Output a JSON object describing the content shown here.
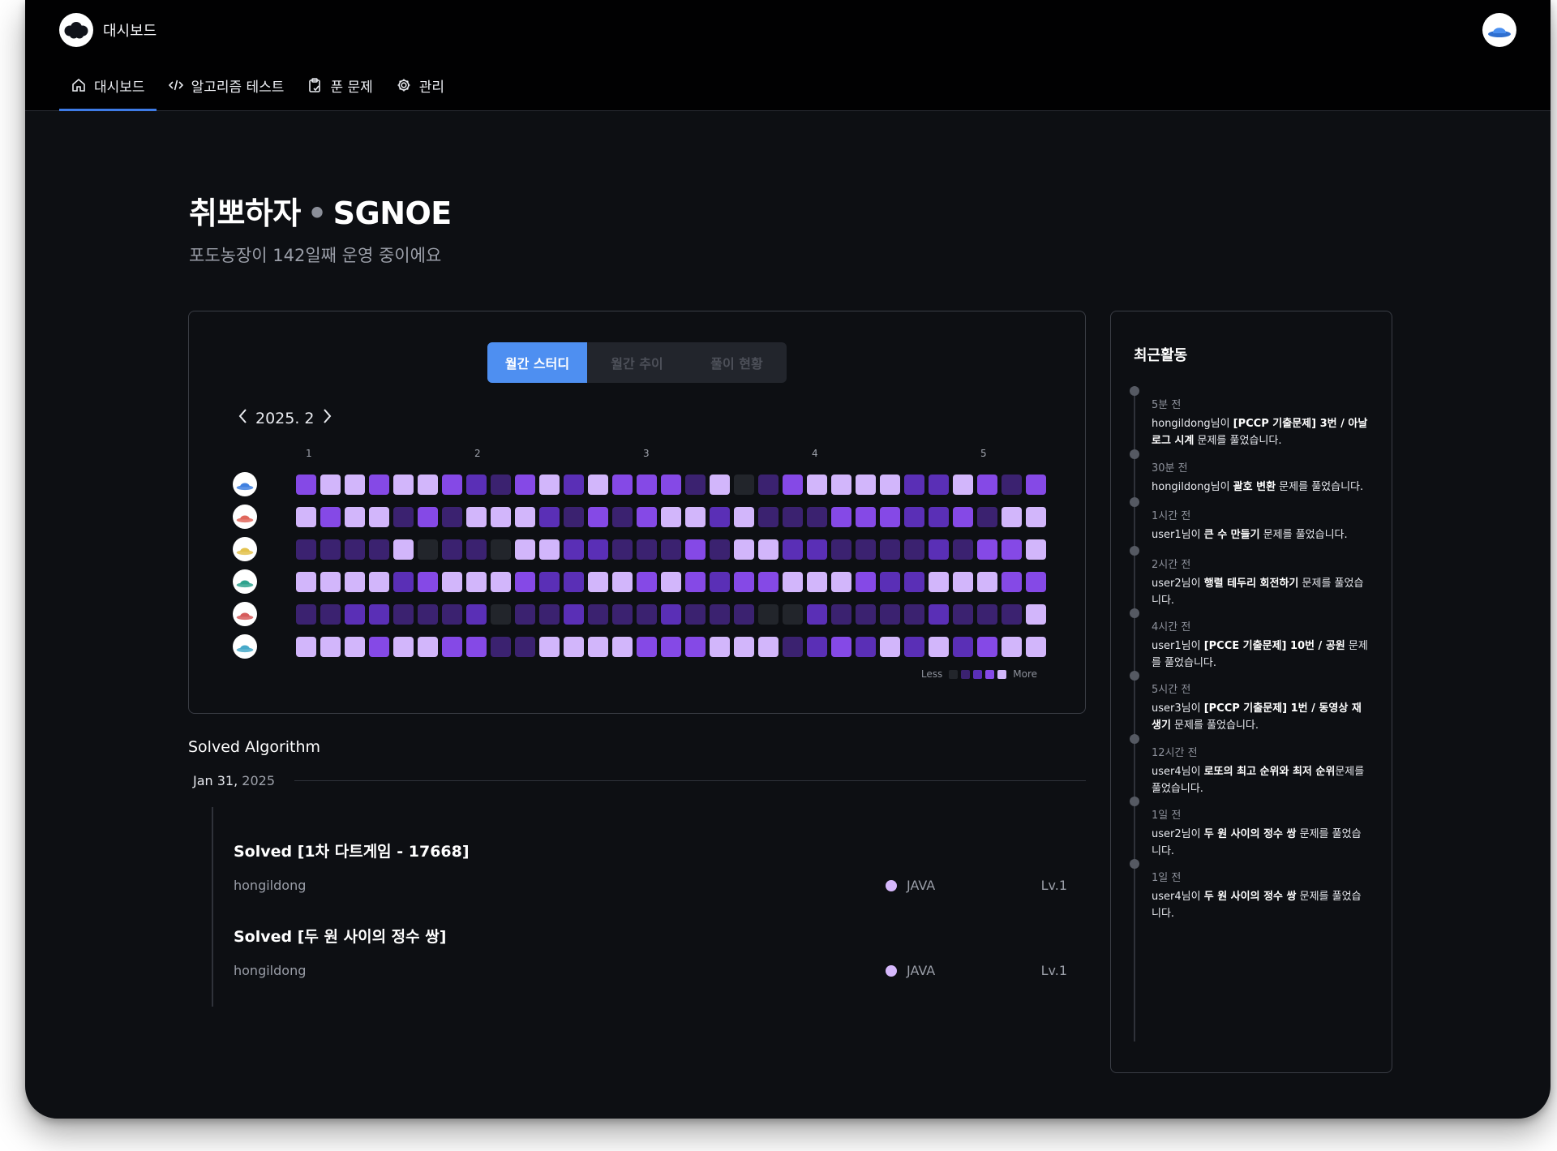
{
  "app": {
    "brand_title": "대시보드",
    "nav": [
      {
        "label": "대시보드",
        "icon": "home-icon",
        "active": true
      },
      {
        "label": "알고리즘 테스트",
        "icon": "code-icon",
        "active": false
      },
      {
        "label": "푼 문제",
        "icon": "clipboard-icon",
        "active": false
      },
      {
        "label": "관리",
        "icon": "gear-icon",
        "active": false
      }
    ]
  },
  "header": {
    "title_main": "취뽀하자",
    "title_sep": "•",
    "title_team": "SGNOE",
    "subtitle": "포도농장이 142일째 운영 중이에요"
  },
  "study": {
    "tabs": [
      "월간 스터디",
      "월간 추이",
      "풀이 현황"
    ],
    "active_tab": 0,
    "month": "2025. 2",
    "week_labels": [
      "1",
      "2",
      "3",
      "4",
      "5"
    ],
    "legend_less": "Less",
    "legend_more": "More",
    "level_colors": [
      "#22252b",
      "#3b2270",
      "#5a2fb6",
      "#8549e6",
      "#d2b6fb"
    ],
    "members": [
      {
        "avatar_color": "#3f80e0",
        "levels": [
          3,
          4,
          4,
          3,
          4,
          4,
          3,
          2,
          1,
          3,
          4,
          2,
          4,
          3,
          3,
          3,
          1,
          4,
          0,
          1,
          3,
          4,
          4,
          4,
          4,
          2,
          2,
          4,
          3,
          1,
          3
        ]
      },
      {
        "avatar_color": "#e0675c",
        "levels": [
          4,
          3,
          4,
          4,
          1,
          3,
          1,
          4,
          4,
          4,
          2,
          1,
          3,
          1,
          3,
          4,
          4,
          2,
          4,
          1,
          1,
          1,
          3,
          3,
          3,
          2,
          2,
          3,
          1,
          4,
          4
        ]
      },
      {
        "avatar_color": "#e3c24e",
        "levels": [
          1,
          1,
          1,
          1,
          4,
          0,
          1,
          1,
          0,
          4,
          4,
          2,
          2,
          1,
          1,
          1,
          3,
          1,
          4,
          4,
          2,
          2,
          1,
          1,
          1,
          1,
          2,
          1,
          3,
          3,
          4
        ]
      },
      {
        "avatar_color": "#2fa38e",
        "levels": [
          4,
          4,
          4,
          4,
          2,
          3,
          4,
          4,
          4,
          3,
          2,
          2,
          4,
          4,
          3,
          4,
          3,
          2,
          3,
          3,
          4,
          4,
          4,
          3,
          2,
          2,
          4,
          4,
          4,
          3,
          3
        ]
      },
      {
        "avatar_color": "#d65c5c",
        "levels": [
          1,
          1,
          2,
          2,
          1,
          1,
          1,
          2,
          0,
          1,
          1,
          2,
          1,
          1,
          1,
          2,
          1,
          1,
          1,
          0,
          0,
          2,
          1,
          1,
          1,
          1,
          2,
          1,
          1,
          1,
          4
        ]
      },
      {
        "avatar_color": "#47a9c9",
        "levels": [
          4,
          4,
          4,
          3,
          4,
          4,
          3,
          3,
          1,
          1,
          4,
          4,
          4,
          4,
          3,
          3,
          3,
          4,
          4,
          4,
          1,
          2,
          3,
          2,
          4,
          2,
          4,
          2,
          3,
          4,
          4
        ]
      }
    ]
  },
  "solved": {
    "section_title": "Solved Algorithm",
    "date": "Jan 31,",
    "date_year": "2025",
    "items": [
      {
        "title": "Solved [1차 다트게임 - 17668]",
        "user": "hongildong",
        "language": "JAVA",
        "level": "Lv.1"
      },
      {
        "title": "Solved [두 원 사이의 정수 쌍]",
        "user": "hongildong",
        "language": "JAVA",
        "level": "Lv.1"
      }
    ]
  },
  "activity": {
    "title": "최근활동",
    "items": [
      {
        "time": "5분 전",
        "user": "hongildong",
        "mid": "님이 ",
        "problem": "[PCCP 기출문제] 3번 / 아날로그 시계",
        "tail": " 문제를 풀었습니다."
      },
      {
        "time": "30분 전",
        "user": "hongildong",
        "mid": "님이 ",
        "problem": "괄호 변환",
        "tail": " 문제를 풀었습니다."
      },
      {
        "time": "1시간 전",
        "user": "user1",
        "mid": "님이 ",
        "problem": "큰 수 만들기",
        "tail": " 문제를 풀었습니다."
      },
      {
        "time": "2시간 전",
        "user": "user2",
        "mid": "님이 ",
        "problem": "행렬 테두리 회전하기",
        "tail": " 문제를 풀었습니다."
      },
      {
        "time": "4시간 전",
        "user": "user1",
        "mid": "님이 ",
        "problem": "[PCCE 기출문제] 10번 / 공원",
        "tail": " 문제를 풀었습니다."
      },
      {
        "time": "5시간 전",
        "user": "user3",
        "mid": "님이 ",
        "problem": "[PCCP 기출문제] 1번 / 동영상 재생기",
        "tail": " 문제를 풀었습니다."
      },
      {
        "time": "12시간 전",
        "user": "user4",
        "mid": "님이 ",
        "problem": "로또의 최고 순위와 최저 순위",
        "tail": "문제를 풀었습니다."
      },
      {
        "time": "1일 전",
        "user": "user2",
        "mid": "님이 ",
        "problem": "두 원 사이의 정수 쌍",
        "tail": " 문제를 풀었습니다."
      },
      {
        "time": "1일 전",
        "user": "user4",
        "mid": "님이 ",
        "problem": "두 원 사이의 정수 쌍",
        "tail": " 문제를 풀었습니다."
      }
    ]
  }
}
